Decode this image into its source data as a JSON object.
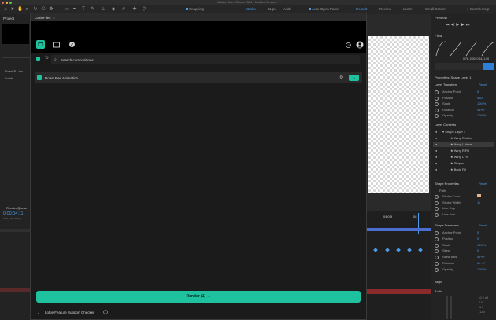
{
  "app": {
    "window_title": "Adobe After Effects 2024 - Untitled Project *",
    "toolbar": {
      "snapping_label": "Snapping",
      "stroke_label": "Stroke",
      "stroke_value": "11 px",
      "add_label": "Add:",
      "auto_open_label": "Auto-Open Panel",
      "workspace_default": "Default",
      "workspace_review": "Review",
      "workspace_learn": "Learn",
      "workspace_small_screen": "Small Screen",
      "search_help_placeholder": "Search Help"
    }
  },
  "left_panel": {
    "project_tab": "Project",
    "items": [
      "Roast B...ion",
      "Solids"
    ],
    "render_queue_tab": "Render Queue",
    "timecode": "0:00:04:11",
    "timecode_sub": "00111 (25.00 fps)"
  },
  "plugin": {
    "title": "LottieFiles",
    "search_placeholder": "Search compositions...",
    "composition_name": "Roast Bee Animation",
    "render_label": "Render (1)",
    "footer_label": "Lottie Feature Support Checker"
  },
  "timeline": {
    "marks": [
      "04:00f",
      "08"
    ]
  },
  "right_panel": {
    "preview_tab": "Preview",
    "flow_tab": "Flow",
    "flow_value": "0.76, 0.00, 0.24, 1.00",
    "properties_title": "Properties: Shape Layer 1",
    "layer_transform_title": "Layer Transform",
    "reset_label": "Reset",
    "layer_transform_rows": [
      {
        "name": "Anchor Point",
        "value": "0"
      },
      {
        "name": "Position",
        "value": "960"
      },
      {
        "name": "Scale",
        "value": "100 %"
      },
      {
        "name": "Rotation",
        "value": "0x+0°"
      },
      {
        "name": "Opacity",
        "value": "100 %"
      }
    ],
    "layer_contents_title": "Layer Contents",
    "layer_contents": [
      "Shape Layer 1",
      "Wing R shine",
      "Wing L shine",
      "Wing R Fill",
      "Wing L Fill",
      "Stripes",
      "Body Fill"
    ],
    "shape_properties_title": "Shape Properties",
    "path_label": "Path",
    "shape_rows": [
      {
        "name": "Stroke Color",
        "value": ""
      },
      {
        "name": "Stroke Width",
        "value": "11"
      },
      {
        "name": "Line Cap",
        "value": ""
      },
      {
        "name": "Line Join",
        "value": ""
      }
    ],
    "shape_transform_title": "Shape Transform",
    "shape_transform_rows": [
      {
        "name": "Anchor Point",
        "value": "0"
      },
      {
        "name": "Position",
        "value": "0"
      },
      {
        "name": "Scale",
        "value": "100 %"
      },
      {
        "name": "Skew",
        "value": "0"
      },
      {
        "name": "Skew Axis",
        "value": "0x+0°"
      },
      {
        "name": "Rotation",
        "value": "0x+0°"
      },
      {
        "name": "Opacity",
        "value": "100 %"
      }
    ],
    "align_title": "Align",
    "audio_title": "Audio",
    "audio_scale": [
      "12.0 dB",
      "0.0",
      "-6.0",
      "-12.0"
    ]
  },
  "colors": {
    "accent_green": "#1fc29f",
    "ae_blue": "#4a9be8"
  }
}
